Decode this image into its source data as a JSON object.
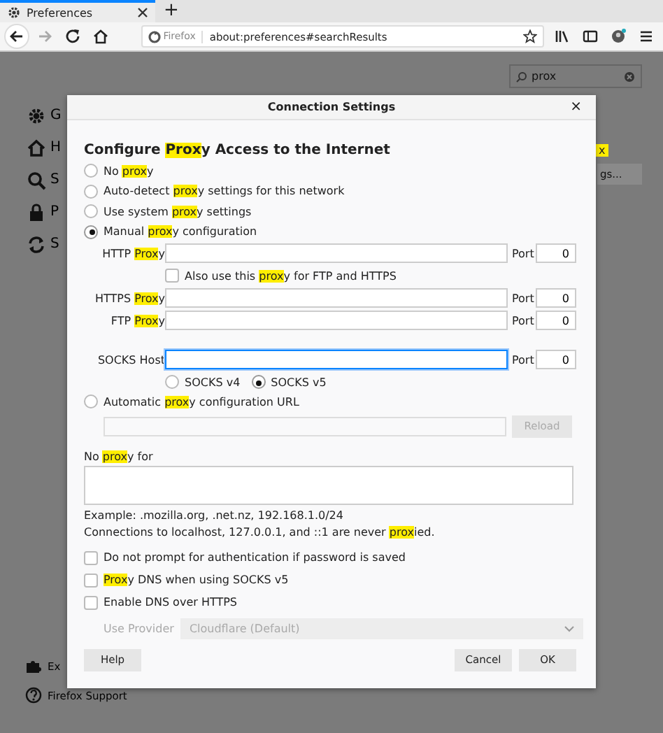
{
  "browser": {
    "tabs": [
      {
        "title": "Preferences",
        "selected": true
      }
    ],
    "new_tab": "+",
    "identity": "Firefox",
    "url": "about:preferences#searchResults"
  },
  "preferences": {
    "search": {
      "value": "prox"
    },
    "sidebar": [
      {
        "label": "G",
        "kind": "gear"
      },
      {
        "label": "H",
        "kind": "home"
      },
      {
        "label": "S",
        "kind": "search"
      },
      {
        "label": "P",
        "kind": "lock"
      },
      {
        "label": "S",
        "kind": "sync"
      }
    ],
    "footer": [
      {
        "label": "Ex",
        "kind": "puzzle"
      },
      {
        "label": "Firefox Support",
        "kind": "help"
      }
    ],
    "result_highlight": "x",
    "settings_button": "gs..."
  },
  "dialog": {
    "title": "Connection Settings",
    "close": "×",
    "heading": [
      {
        "text": "Configure ",
        "highlight": false
      },
      {
        "text": "Prox",
        "highlight": true
      },
      {
        "text": "y Access to the Internet",
        "highlight": false
      }
    ],
    "modes": [
      {
        "selected": false,
        "label": [
          {
            "text": "No ",
            "highlight": false
          },
          {
            "text": "prox",
            "highlight": true
          },
          {
            "text": "y",
            "highlight": false
          }
        ]
      },
      {
        "selected": false,
        "label": [
          {
            "text": "Auto-detect ",
            "highlight": false
          },
          {
            "text": "prox",
            "highlight": true
          },
          {
            "text": "y settings for this network",
            "highlight": false
          }
        ]
      },
      {
        "selected": false,
        "label": [
          {
            "text": "Use system ",
            "highlight": false
          },
          {
            "text": "prox",
            "highlight": true
          },
          {
            "text": "y settings",
            "highlight": false
          }
        ]
      },
      {
        "selected": true,
        "label": [
          {
            "text": "Manual ",
            "highlight": false
          },
          {
            "text": "prox",
            "highlight": true
          },
          {
            "text": "y configuration",
            "highlight": false
          }
        ]
      }
    ],
    "http": {
      "label": [
        {
          "text": "HTTP ",
          "highlight": false
        },
        {
          "text": "Prox",
          "highlight": true
        },
        {
          "text": "y",
          "highlight": false
        }
      ],
      "port_label": "Port",
      "port": "0",
      "focused": false
    },
    "share": {
      "checked": false,
      "label": [
        {
          "text": "Also use this ",
          "highlight": false
        },
        {
          "text": "prox",
          "highlight": true
        },
        {
          "text": "y for FTP and HTTPS",
          "highlight": false
        }
      ]
    },
    "proxies": [
      {
        "label": [
          {
            "text": "HTTPS ",
            "highlight": false
          },
          {
            "text": "Prox",
            "highlight": true
          },
          {
            "text": "y",
            "highlight": false
          }
        ],
        "port_label": "Port",
        "port": "0",
        "focused": false
      },
      {
        "label": [
          {
            "text": "FTP ",
            "highlight": false
          },
          {
            "text": "Prox",
            "highlight": true
          },
          {
            "text": "y",
            "highlight": false
          }
        ],
        "port_label": "Port",
        "port": "0",
        "focused": false
      }
    ],
    "socks": {
      "label": [
        {
          "text": "SOCKS Host",
          "highlight": false
        }
      ],
      "port_label": "Port",
      "port": "0",
      "focused": true
    },
    "socks_versions": [
      {
        "label": "SOCKS v4",
        "selected": false
      },
      {
        "label": "SOCKS v5",
        "selected": true
      }
    ],
    "auto": {
      "selected": false,
      "label": [
        {
          "text": "Automatic ",
          "highlight": false
        },
        {
          "text": "prox",
          "highlight": true
        },
        {
          "text": "y configuration URL",
          "highlight": false
        }
      ],
      "reload": "Reload",
      "disabled": true
    },
    "no_proxy_label": [
      {
        "text": "No ",
        "highlight": false
      },
      {
        "text": "prox",
        "highlight": true
      },
      {
        "text": "y for",
        "highlight": false
      }
    ],
    "example": [
      {
        "text": "Example: .mozilla.org, .net.nz, 192.168.1.0/24",
        "highlight": false
      }
    ],
    "note": [
      {
        "text": "Connections to localhost, 127.0.0.1, and ::1 are never ",
        "highlight": false
      },
      {
        "text": "prox",
        "highlight": true
      },
      {
        "text": "ied.",
        "highlight": false
      }
    ],
    "options": [
      {
        "checked": false,
        "label": [
          {
            "text": "Do not prompt for authentication if password is saved",
            "highlight": false
          }
        ]
      },
      {
        "checked": false,
        "label": [
          {
            "text": "Prox",
            "highlight": true
          },
          {
            "text": "y DNS when using SOCKS v5",
            "highlight": false
          }
        ]
      },
      {
        "checked": false,
        "label": [
          {
            "text": "Enable DNS over HTTPS",
            "highlight": false
          }
        ]
      }
    ],
    "provider": {
      "label": "Use Provider",
      "value": "Cloudflare (Default)",
      "disabled": true
    },
    "help": "Help",
    "buttons": [
      "Cancel",
      "OK"
    ]
  }
}
